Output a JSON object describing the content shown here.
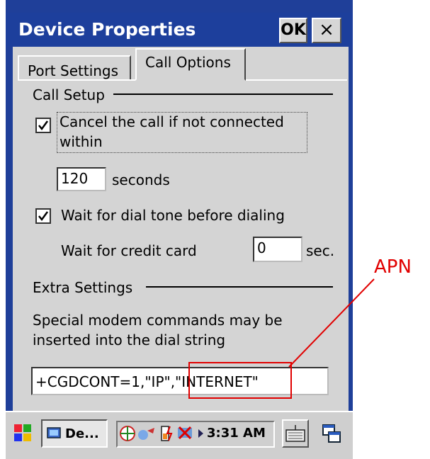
{
  "window": {
    "title": "Device Properties",
    "ok_label": "OK",
    "close_label": "×"
  },
  "tabs": [
    {
      "label": "Port Settings",
      "active": false
    },
    {
      "label": "Call Options",
      "active": true
    }
  ],
  "call_setup": {
    "heading": "Call Setup",
    "cancel_call_label_line1": "Cancel the call if not connected",
    "cancel_call_label_line2": "within",
    "cancel_call_checked": true,
    "seconds_value": "120",
    "seconds_label": "seconds",
    "wait_dial_tone_label": "Wait for dial tone before dialing",
    "wait_dial_tone_checked": true,
    "credit_card_label": "Wait for credit card",
    "credit_card_value": "0",
    "sec_label": "sec."
  },
  "extra_settings": {
    "heading": "Extra Settings",
    "description_line1": "Special modem commands may be",
    "description_line2": "inserted into the dial string",
    "dial_string_value": "+CGDCONT=1,\"IP\",\"INTERNET\""
  },
  "annotation": {
    "label": "APN",
    "color": "#e10000"
  },
  "taskbar": {
    "task_label": "De...",
    "time": "3:31 AM"
  },
  "colors": {
    "titlebar": "#1d3f9c",
    "face": "#d4d4d4"
  }
}
